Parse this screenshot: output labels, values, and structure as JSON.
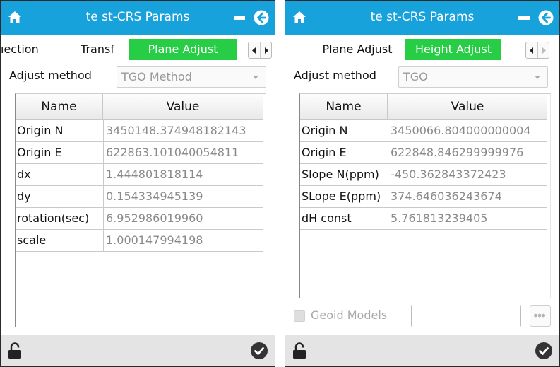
{
  "left": {
    "title": "te st-CRS Params",
    "tabs": [
      "ıection",
      "Transf",
      "Plane Adjust"
    ],
    "active_tab": "Plane Adjust",
    "adjust_method_label": "Adjust method",
    "adjust_method_value": "TGO Method",
    "table_headers": {
      "name": "Name",
      "value": "Value"
    },
    "rows": [
      {
        "name": "Origin N",
        "value": "3450148.374948182143"
      },
      {
        "name": "Origin E",
        "value": "622863.101040054811"
      },
      {
        "name": "dx",
        "value": "1.444801818114"
      },
      {
        "name": "dy",
        "value": "0.154334945139"
      },
      {
        "name": "rotation(sec)",
        "value": "6.952986019960"
      },
      {
        "name": "scale",
        "value": "1.000147994198"
      }
    ]
  },
  "right": {
    "title": "te st-CRS Params",
    "tabs": [
      "Plane Adjust",
      "Height Adjust"
    ],
    "active_tab": "Height Adjust",
    "adjust_method_label": "Adjust method",
    "adjust_method_value": "TGO",
    "table_headers": {
      "name": "Name",
      "value": "Value"
    },
    "rows": [
      {
        "name": "Origin N",
        "value": "3450066.804000000004"
      },
      {
        "name": "Origin E",
        "value": "622848.846299999976"
      },
      {
        "name": "Slope N(ppm)",
        "value": "-450.362843372423"
      },
      {
        "name": "SLope E(ppm)",
        "value": "374.646036243674"
      },
      {
        "name": "dH const",
        "value": "5.761813239405"
      }
    ],
    "geoid_label": "Geoid Models",
    "geoid_checked": false,
    "geoid_value": ""
  },
  "icons": {
    "home": "home-icon",
    "minimize": "minimize-icon",
    "back": "back-arrow-icon",
    "arrows": "chevron-left-right-icon",
    "lock": "unlocked-padlock-icon",
    "confirm": "checkmark-circle-icon",
    "more": "more-dots-icon"
  },
  "colors": {
    "titlebar": "#17a2dc",
    "active_tab": "#27cd45",
    "footer": "#e4e4e4",
    "value_text": "#8a8a8a"
  }
}
